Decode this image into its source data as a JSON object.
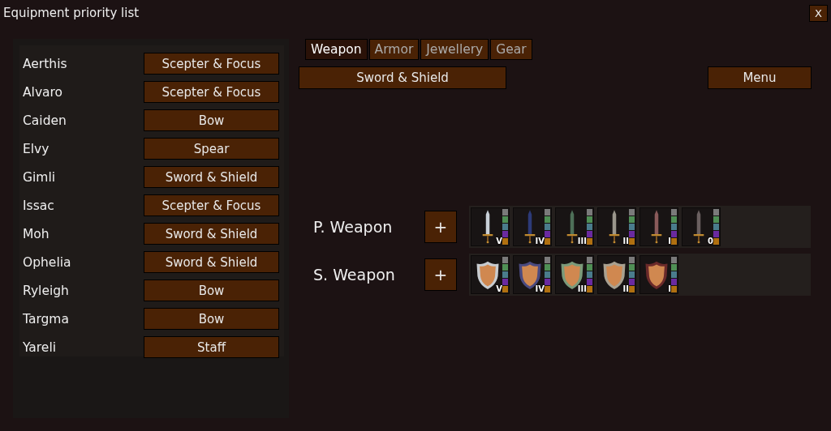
{
  "window": {
    "title": "Equipment priority list",
    "close": "X"
  },
  "characters": [
    {
      "name": "Aerthis",
      "loadout": "Scepter & Focus"
    },
    {
      "name": "Alvaro",
      "loadout": "Scepter & Focus"
    },
    {
      "name": "Caiden",
      "loadout": "Bow"
    },
    {
      "name": "Elvy",
      "loadout": "Spear"
    },
    {
      "name": "Gimli",
      "loadout": "Sword & Shield"
    },
    {
      "name": "Issac",
      "loadout": "Scepter & Focus"
    },
    {
      "name": "Moh",
      "loadout": "Sword & Shield"
    },
    {
      "name": "Ophelia",
      "loadout": "Sword & Shield"
    },
    {
      "name": "Ryleigh",
      "loadout": "Bow"
    },
    {
      "name": "Targma",
      "loadout": "Bow"
    },
    {
      "name": "Yareli",
      "loadout": "Staff"
    }
  ],
  "tabs": [
    {
      "label": "Weapon",
      "selected": true
    },
    {
      "label": "Armor",
      "selected": false
    },
    {
      "label": "Jewellery",
      "selected": false
    },
    {
      "label": "Gear",
      "selected": false
    }
  ],
  "loadout_button": "Sword & Shield",
  "menu_button": "Menu",
  "slots": [
    {
      "label": "P. Weapon",
      "add": "+",
      "items": [
        {
          "kind": "sword",
          "tier": "V",
          "color": "#c8d0d8"
        },
        {
          "kind": "sword",
          "tier": "IV",
          "color": "#2c3a78"
        },
        {
          "kind": "sword",
          "tier": "III",
          "color": "#4e7058"
        },
        {
          "kind": "sword",
          "tier": "II",
          "color": "#9a968c"
        },
        {
          "kind": "sword",
          "tier": "I",
          "color": "#8a5a5a"
        },
        {
          "kind": "sword",
          "tier": "0",
          "color": "#6a6060"
        }
      ]
    },
    {
      "label": "S. Weapon",
      "add": "+",
      "items": [
        {
          "kind": "shield",
          "tier": "V",
          "color": "#c8ccd0"
        },
        {
          "kind": "shield",
          "tier": "IV",
          "color": "#4a4a80"
        },
        {
          "kind": "shield",
          "tier": "III",
          "color": "#7a9a7a"
        },
        {
          "kind": "shield",
          "tier": "II",
          "color": "#a8a090"
        },
        {
          "kind": "shield",
          "tier": "I",
          "color": "#6a2a2a"
        }
      ]
    }
  ]
}
